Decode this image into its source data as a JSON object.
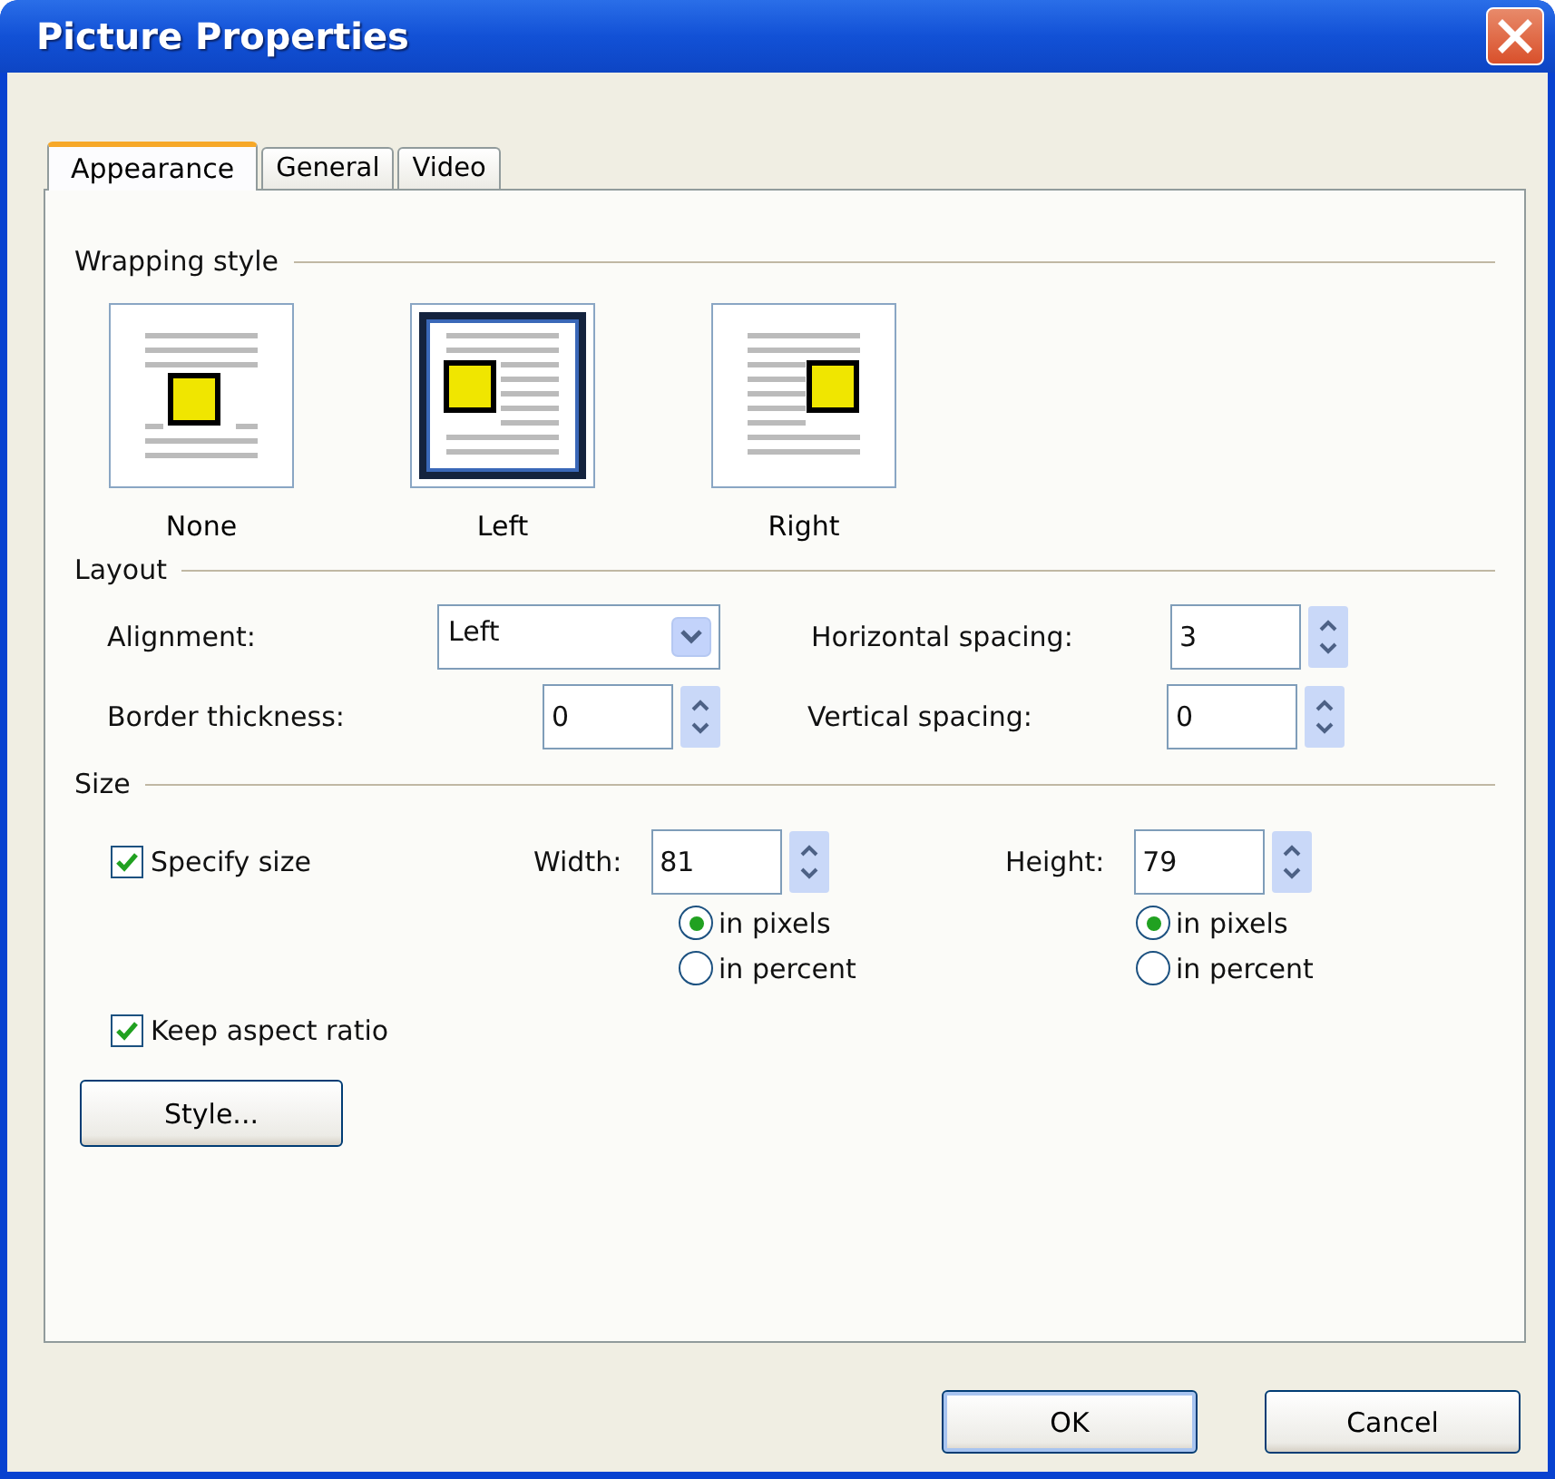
{
  "window": {
    "title": "Picture Properties"
  },
  "tabs": [
    {
      "label": "Appearance",
      "selected": true
    },
    {
      "label": "General",
      "selected": false
    },
    {
      "label": "Video",
      "selected": false
    }
  ],
  "wrapping_style": {
    "heading": "Wrapping style",
    "options": [
      {
        "kind": "none",
        "label": "None",
        "selected": false
      },
      {
        "kind": "left",
        "label": "Left",
        "selected": true
      },
      {
        "kind": "right",
        "label": "Right",
        "selected": false
      }
    ]
  },
  "layout": {
    "heading": "Layout",
    "alignment": {
      "label": "Alignment:",
      "value": "Left"
    },
    "border_thickness": {
      "label": "Border thickness:",
      "value": "0"
    },
    "horizontal_spacing": {
      "label": "Horizontal spacing:",
      "value": "3"
    },
    "vertical_spacing": {
      "label": "Vertical spacing:",
      "value": "0"
    }
  },
  "size": {
    "heading": "Size",
    "specify_size": {
      "label": "Specify size",
      "checked": true
    },
    "width": {
      "label": "Width:",
      "value": "81",
      "units": [
        {
          "label": "in pixels",
          "selected": true
        },
        {
          "label": "in percent",
          "selected": false
        }
      ]
    },
    "height": {
      "label": "Height:",
      "value": "79",
      "units": [
        {
          "label": "in pixels",
          "selected": true
        },
        {
          "label": "in percent",
          "selected": false
        }
      ]
    },
    "keep_aspect_ratio": {
      "label": "Keep aspect ratio",
      "checked": true
    }
  },
  "style_button": "Style...",
  "buttons": [
    "OK",
    "Cancel"
  ]
}
